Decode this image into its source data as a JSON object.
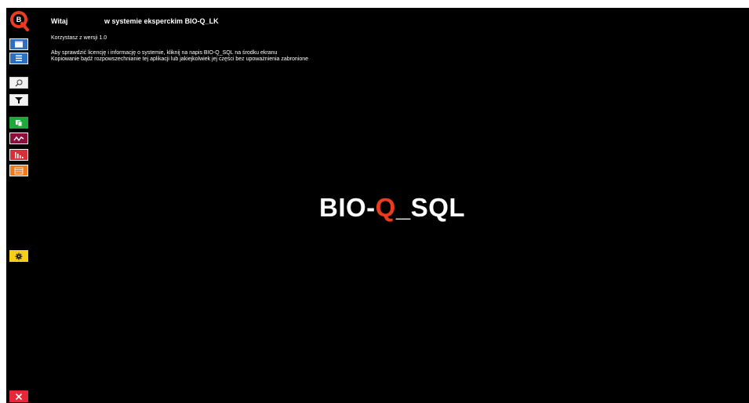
{
  "header": {
    "greeting": "Witaj",
    "system": "w systemie eksperckim BIO-Q_LK"
  },
  "version_text": "Korzystasz z wersji 1.0",
  "info_line1": "Aby sprawdzić licencję i informację o systemie, kliknij na napis BIO-Q_SQL na środku ekranu",
  "info_line2": "Kopiowanie bądź rozpowszechnianie tej aplikacji lub jakiejkolwiek jej części bez upoważnienia zabronione",
  "brand": {
    "part1": "BIO-",
    "part2": "Q",
    "part3": "_SQL"
  },
  "logo_letter": "B",
  "sidebar": {
    "buttons": [
      {
        "icon": "window-icon",
        "color": "#2f6fbe"
      },
      {
        "icon": "list-icon",
        "color": "#2f6fbe"
      },
      {
        "icon": "search-icon",
        "color": "#f2f2f2"
      },
      {
        "icon": "filter-icon",
        "color": "#f2f2f2"
      },
      {
        "icon": "copy-icon",
        "color": "#1daa3a"
      },
      {
        "icon": "line-chart-icon",
        "color": "#8a0f3d"
      },
      {
        "icon": "bar-chart-icon",
        "color": "#d6303a"
      },
      {
        "icon": "table-icon",
        "color": "#f07a1a"
      },
      {
        "icon": "gear-icon",
        "color": "#f5cf1e"
      },
      {
        "icon": "close-icon",
        "color": "#e5283a"
      }
    ]
  }
}
